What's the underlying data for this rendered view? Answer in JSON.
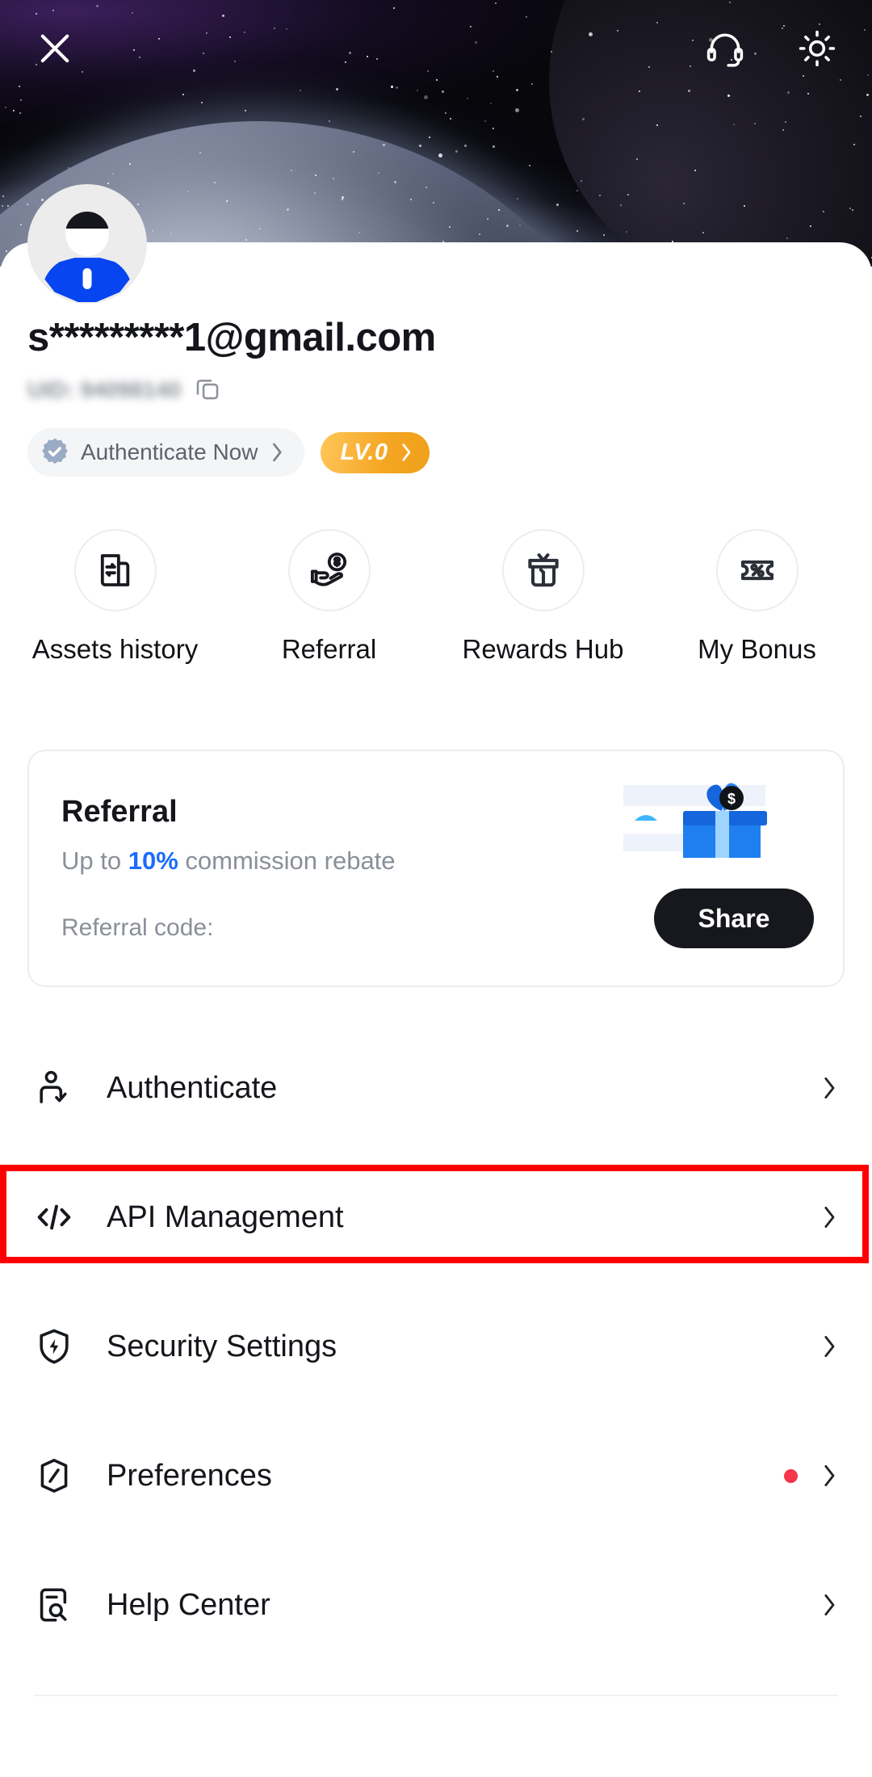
{
  "topbar": {
    "close_label": "×",
    "close_icon": "close-icon",
    "support_icon": "headset-icon",
    "theme_icon": "brightness-sun-icon"
  },
  "account": {
    "avatar_icon": "user-avatar",
    "email": "s*********1@gmail.com",
    "uid_text": "UID: 94098140",
    "copy_icon": "copy-icon",
    "authenticate_badge": {
      "label": "Authenticate Now",
      "icon": "verified-rosette-icon",
      "chevron": "›"
    },
    "level_badge": {
      "label": "LV.0",
      "chevron": "›"
    }
  },
  "quick_actions": [
    {
      "label": "Assets history",
      "icon": "assets-history-icon"
    },
    {
      "label": "Referral",
      "icon": "hand-coin-icon"
    },
    {
      "label": "Rewards Hub",
      "icon": "gift-box-icon"
    },
    {
      "label": "My Bonus",
      "icon": "percent-ticket-icon"
    }
  ],
  "referral_card": {
    "title": "Referral",
    "subtitle_prefix": "Up to ",
    "subtitle_percent": "10%",
    "subtitle_suffix": " commission rebate",
    "code_label": "Referral code:",
    "code_value": "",
    "share_label": "Share",
    "illustration_icon": "gift-box-illustration"
  },
  "menu": [
    {
      "label": "Authenticate",
      "icon": "user-check-icon",
      "badge_dot": false,
      "chevron": "›",
      "highlighted": false
    },
    {
      "label": "API Management",
      "icon": "code-brackets-icon",
      "badge_dot": false,
      "chevron": "›",
      "highlighted": false
    },
    {
      "label": "Security Settings",
      "icon": "shield-bolt-icon",
      "badge_dot": false,
      "chevron": "›",
      "highlighted": true
    },
    {
      "label": "Preferences",
      "icon": "hexagon-slash-icon",
      "badge_dot": true,
      "chevron": "›",
      "highlighted": false
    },
    {
      "label": "Help Center",
      "icon": "help-search-doc-icon",
      "badge_dot": false,
      "chevron": "›",
      "highlighted": false
    }
  ],
  "colors": {
    "accent_blue": "#1a6cff",
    "level_orange": "#f5a623",
    "badge_red": "#f5364b",
    "highlight_red": "#ff0000",
    "text_primary": "#14161b",
    "text_secondary": "#8a8f98"
  }
}
